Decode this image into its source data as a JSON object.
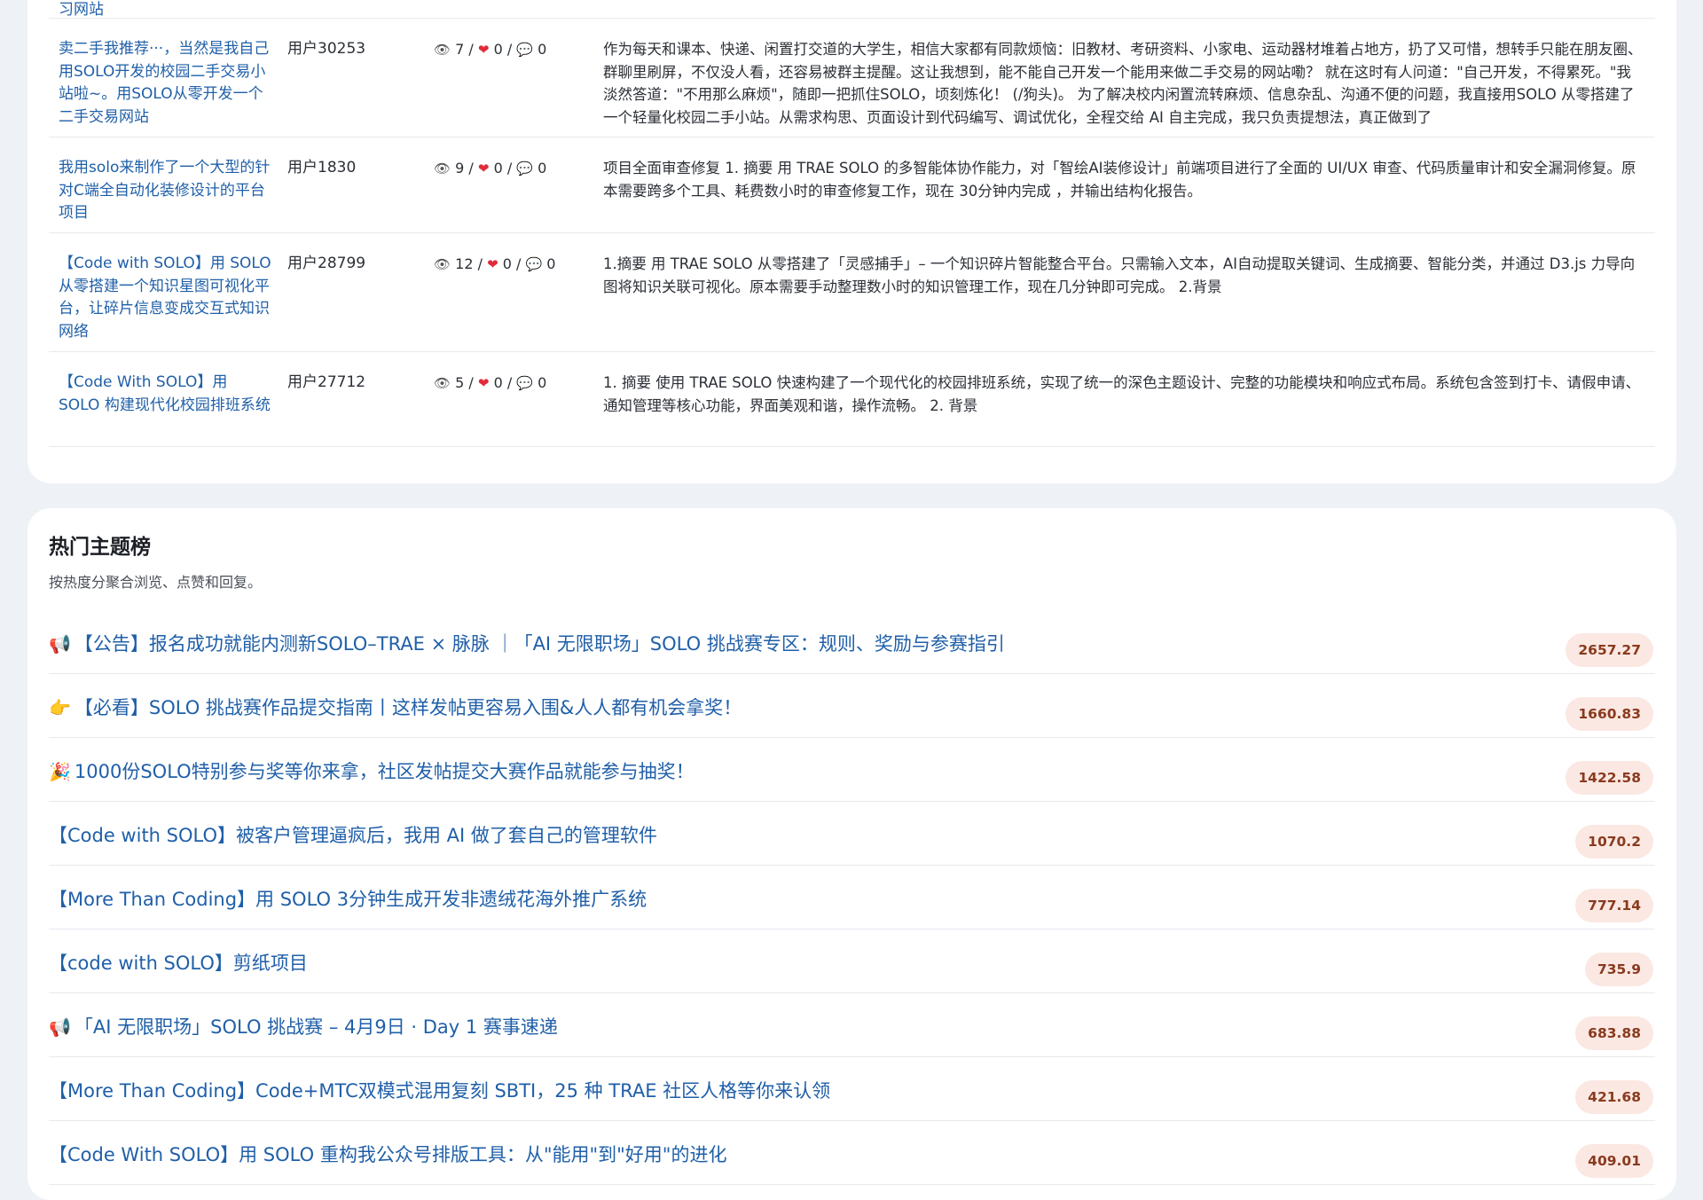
{
  "posts": {
    "top_fragment": "习网站",
    "rows": [
      {
        "title": "卖二手我推荐···，当然是我自己用SOLO开发的校园二手交易小站啦~。用SOLO从零开发一个二手交易网站",
        "user": "用户30253",
        "views": "7",
        "likes": "0",
        "replies": "0",
        "excerpt": "作为每天和课本、快递、闲置打交道的大学生，相信大家都有同款烦恼：旧教材、考研资料、小家电、运动器材堆着占地方，扔了又可惜，想转手只能在朋友圈、群聊里刷屏，不仅没人看，还容易被群主提醒。这让我想到，能不能自己开发一个能用来做二手交易的网站嘞？ 就在这时有人问道：\"自己开发，不得累死。\"我淡然答道：\"不用那么麻烦\"，随即一把抓住SOLO，顷刻炼化！ (/狗头)。 为了解决校内闲置流转麻烦、信息杂乱、沟通不便的问题，我直接用SOLO 从零搭建了一个轻量化校园二手小站。从需求构思、页面设计到代码编写、调试优化，全程交给 AI 自主完成，我只负责提想法，真正做到了"
      },
      {
        "title": "我用solo来制作了一个大型的针对C端全自动化装修设计的平台项目",
        "user": "用户1830",
        "views": "9",
        "likes": "0",
        "replies": "0",
        "excerpt": "项目全面审查修复 1. 摘要 用 TRAE SOLO 的多智能体协作能力，对「智绘AI装修设计」前端项目进行了全面的 UI/UX 审查、代码质量审计和安全漏洞修复。原本需要跨多个工具、耗费数小时的审查修复工作，现在 30分钟内完成 ，并输出结构化报告。"
      },
      {
        "title": "【Code with SOLO】用 SOLO 从零搭建一个知识星图可视化平台，让碎片信息变成交互式知识网络",
        "user": "用户28799",
        "views": "12",
        "likes": "0",
        "replies": "0",
        "excerpt": "1.摘要 用 TRAE SOLO 从零搭建了「灵感捕手」– 一个知识碎片智能整合平台。只需输入文本，AI自动提取关键词、生成摘要、智能分类，并通过 D3.js 力导向图将知识关联可视化。原本需要手动整理数小时的知识管理工作，现在几分钟即可完成。 2.背景"
      },
      {
        "title": "【Code With SOLO】用 SOLO 构建现代化校园排班系统",
        "user": "用户27712",
        "views": "5",
        "likes": "0",
        "replies": "0",
        "excerpt": "1. 摘要 使用 TRAE SOLO 快速构建了一个现代化的校园排班系统，实现了统一的深色主题设计、完整的功能模块和响应式布局。系统包含签到打卡、请假申请、通知管理等核心功能，界面美观和谐，操作流畅。 2. 背景"
      }
    ]
  },
  "hot": {
    "title": "热门主题榜",
    "subtitle": "按热度分聚合浏览、点赞和回复。",
    "items": [
      {
        "emoji": "📢",
        "label": "【公告】报名成功就能内测新SOLO–TRAE × 脉脉 ｜「AI 无限职场」SOLO 挑战赛专区：规则、奖励与参赛指引",
        "score": "2657.27"
      },
      {
        "emoji": "👉",
        "label": "【必看】SOLO 挑战赛作品提交指南丨这样发帖更容易入围&人人都有机会拿奖！",
        "score": "1660.83"
      },
      {
        "emoji": "🎉",
        "label": "1000份SOLO特别参与奖等你来拿，社区发帖提交大赛作品就能参与抽奖！",
        "score": "1422.58"
      },
      {
        "emoji": "",
        "label": "【Code with SOLO】被客户管理逼疯后，我用 AI 做了套自己的管理软件",
        "score": "1070.2"
      },
      {
        "emoji": "",
        "label": "【More Than Coding】用 SOLO 3分钟生成开发非遗绒花海外推广系统",
        "score": "777.14"
      },
      {
        "emoji": "",
        "label": "【code with SOLO】剪纸项目",
        "score": "735.9"
      },
      {
        "emoji": "📢",
        "label": "「AI 无限职场」SOLO 挑战赛 – 4月9日 · Day 1 赛事速递",
        "score": "683.88"
      },
      {
        "emoji": "",
        "label": "【More Than Coding】Code+MTC双模式混用复刻 SBTI，25 种 TRAE 社区人格等你来认领",
        "score": "421.68"
      },
      {
        "emoji": "",
        "label": "【Code With SOLO】用 SOLO 重构我公众号排版工具：从\"能用\"到\"好用\"的进化",
        "score": "409.01"
      }
    ]
  }
}
